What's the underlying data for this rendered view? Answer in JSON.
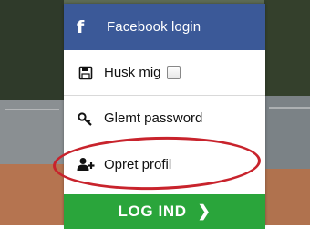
{
  "menu": {
    "facebook": {
      "icon": "facebook-icon",
      "label": "Facebook login"
    },
    "remember": {
      "icon": "floppy-disk-icon",
      "label": "Husk mig",
      "checked": false
    },
    "forgot": {
      "icon": "key-icon",
      "label": "Glemt password"
    },
    "create": {
      "icon": "user-plus-icon",
      "label": "Opret profil"
    },
    "login": {
      "label": "LOG IND",
      "chevron": "❯"
    }
  },
  "colors": {
    "facebook": "#3b5998",
    "login": "#2aa53b",
    "highlight": "#c8232c"
  }
}
